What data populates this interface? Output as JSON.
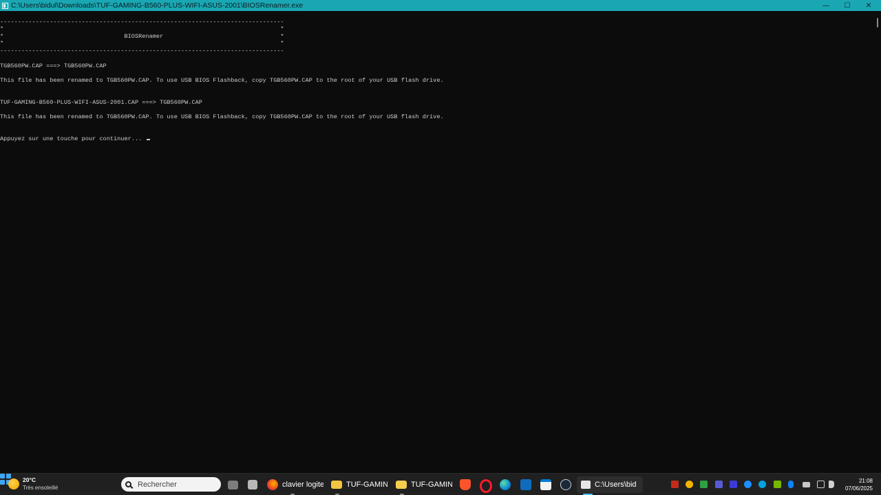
{
  "window": {
    "title": "C:\\Users\\bidul\\Downloads\\TUF-GAMING-B560-PLUS-WIFI-ASUS-2001\\BIOSRenamer.exe",
    "controls": {
      "minimize": "—",
      "maximize": "☐",
      "close": "✕"
    }
  },
  "console": {
    "lines": [
      "--------------------------------------------------------------------------------",
      "*                                                                              *",
      "*                                  BIOSRenamer                                 *",
      "*                                                                              *",
      "--------------------------------------------------------------------------------",
      "",
      "TGB560PW.CAP ===> TGB560PW.CAP",
      "",
      "This file has been renamed to TGB560PW.CAP. To use USB BIOS Flashback, copy TGB560PW.CAP to the root of your USB flash drive.",
      "",
      "",
      "TUF-GAMING-B560-PLUS-WIFI-ASUS-2001.CAP ===> TGB560PW.CAP",
      "",
      "This file has been renamed to TGB560PW.CAP. To use USB BIOS Flashback, copy TGB560PW.CAP to the root of your USB flash drive.",
      "",
      "",
      "Appuyez sur une touche pour continuer... "
    ]
  },
  "taskbar": {
    "weather": {
      "temp": "20°C",
      "condition": "Très ensoleillé"
    },
    "search_placeholder": "Rechercher",
    "apps": [
      {
        "label": "clavier logite",
        "icon": "firefox-icon"
      },
      {
        "label": "TUF-GAMING",
        "icon": "file-explorer-icon"
      },
      {
        "label": "TUF-GAMING",
        "icon": "folder-icon"
      },
      {
        "label": "C:\\Users\\bid",
        "icon": "terminal-icon"
      }
    ],
    "clock": {
      "time": "21:08",
      "date": "07/06/2025"
    }
  },
  "colors": {
    "titlebar": "#1aa7b3",
    "console_bg": "#0c0c0c",
    "console_text": "#cccccc",
    "taskbar_bg": "#202020"
  }
}
